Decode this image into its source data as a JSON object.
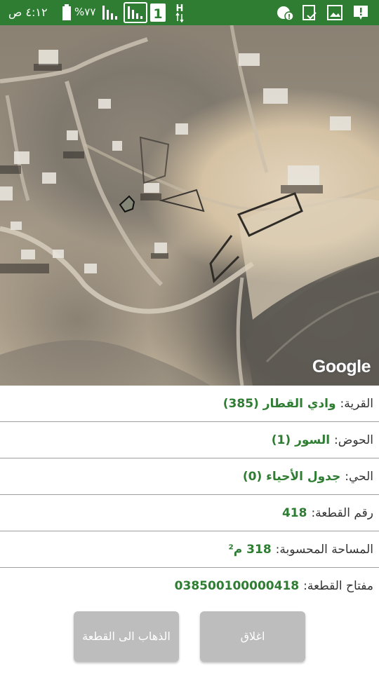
{
  "status_bar": {
    "time": "٤:١٢ ص",
    "battery": "%٧٧",
    "network": "H",
    "sim_slot": "1",
    "icons": [
      "battery-icon",
      "signal-icon",
      "signal-icon",
      "sim-icon",
      "network-type-icon",
      "alert-icon",
      "gallery-icon",
      "clipboard-icon",
      "notification-icon"
    ]
  },
  "map": {
    "attribution": "Google"
  },
  "parcel": {
    "village_label": "القرية:",
    "village_value": "وادي القطار (385)",
    "basin_label": "الحوض:",
    "basin_value": "السور (1)",
    "district_label": "الحي:",
    "district_value": "جدول الأحياء (0)",
    "parcel_no_label": "رقم القطعة:",
    "parcel_no_value": "418",
    "area_label": "المساحة المحسوبة:",
    "area_value": "318 م²",
    "key_label": "مفتاح القطعة:",
    "key_value": "038500100000418"
  },
  "buttons": {
    "goto_label": "الذهاب الى القطعة",
    "close_label": "اغلاق"
  },
  "colors": {
    "accent": "#2e7d32",
    "button_bg": "#bdbdbd"
  }
}
